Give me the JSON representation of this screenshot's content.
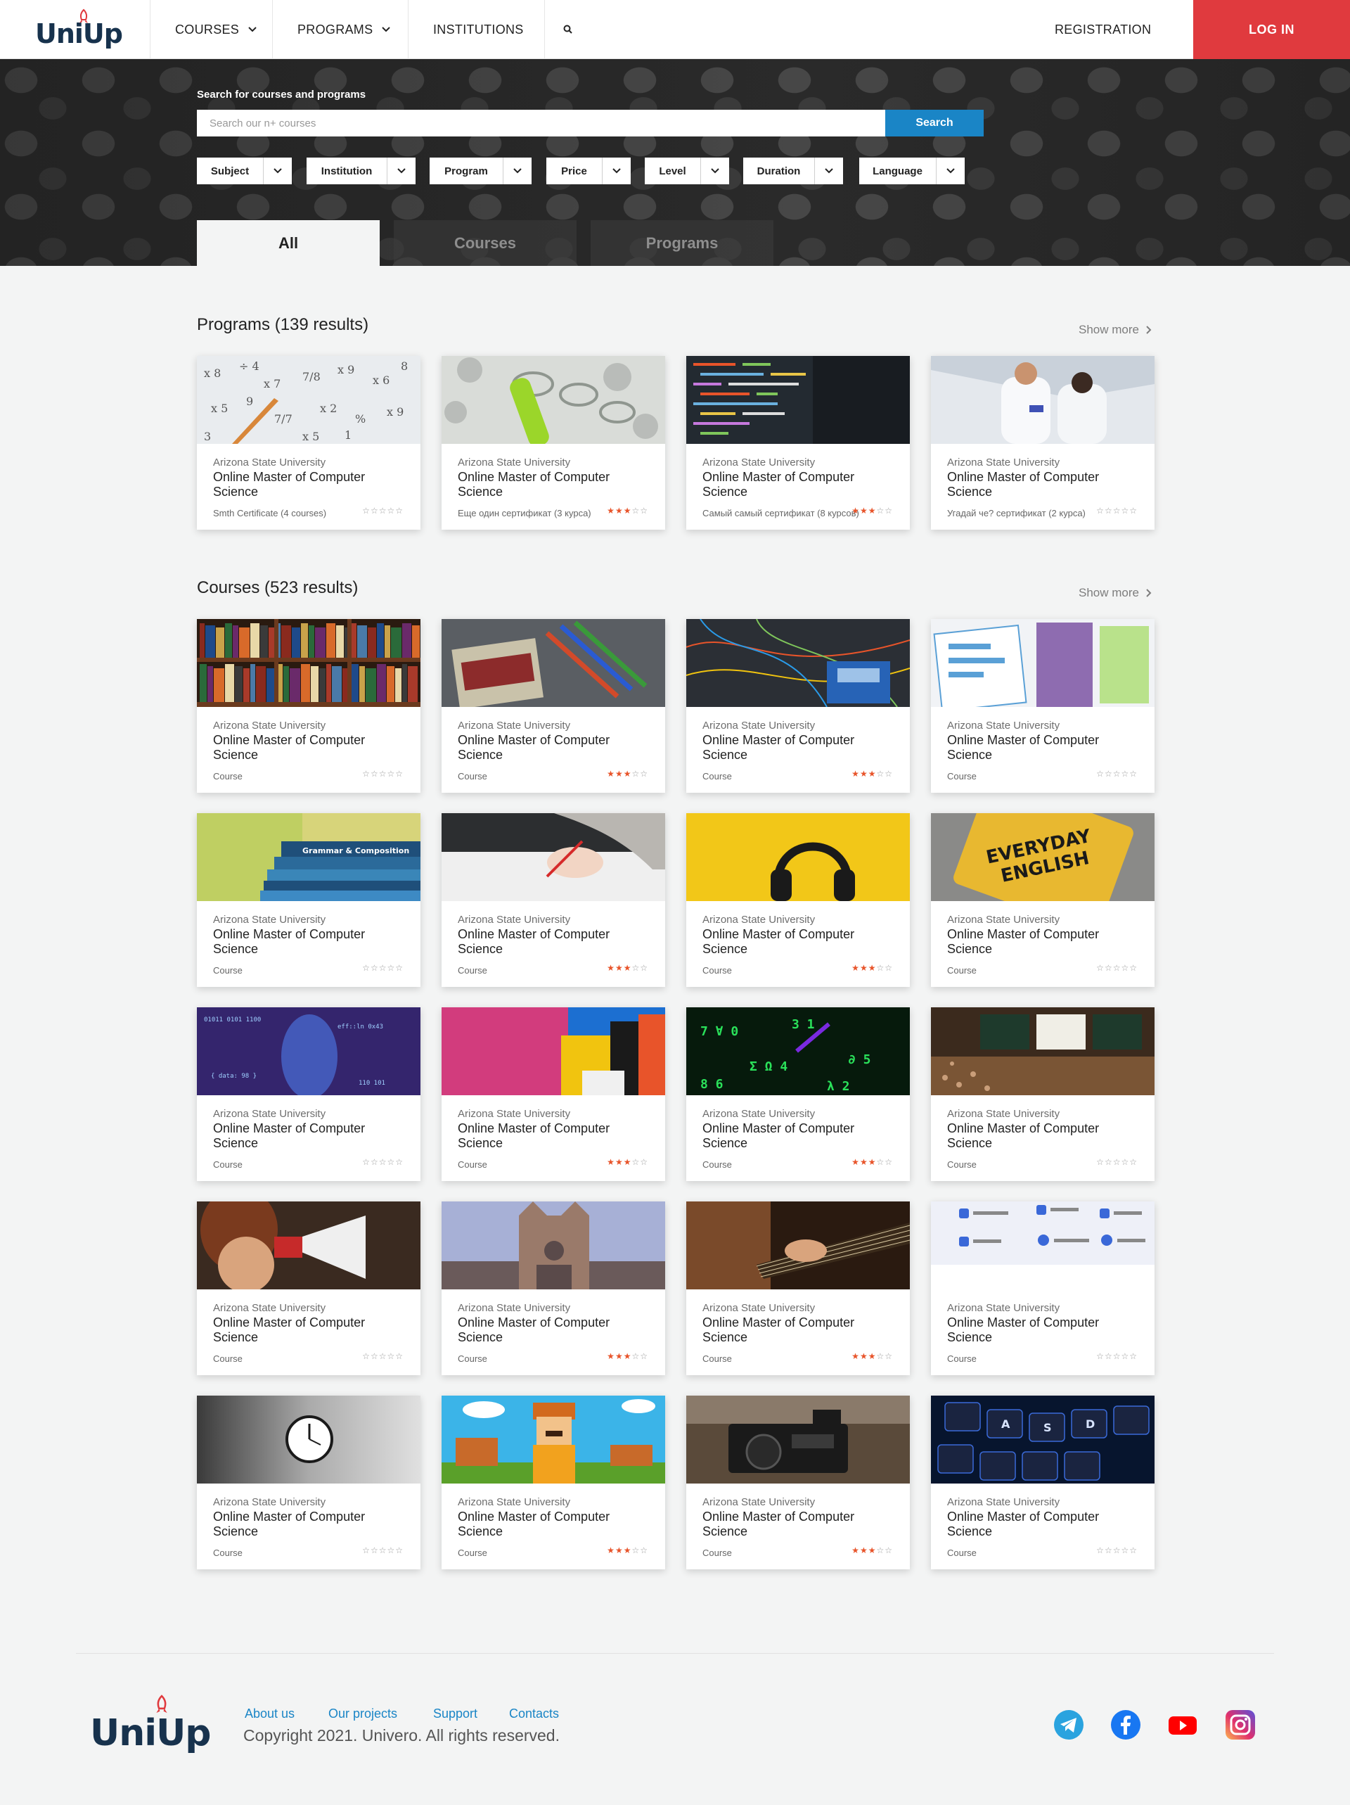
{
  "header": {
    "logo": "UniUp",
    "nav": [
      {
        "label": "COURSES",
        "has_dropdown": true
      },
      {
        "label": "PROGRAMS",
        "has_dropdown": true
      },
      {
        "label": "INSTITUTIONS",
        "has_dropdown": false
      }
    ],
    "search_icon": "search-icon",
    "registration": "REGISTRATION",
    "login": "LOG IN"
  },
  "hero": {
    "label": "Search for courses and programs",
    "search_placeholder": "Search our n+ courses",
    "search_button": "Search",
    "filters": [
      "Subject",
      "Institution",
      "Program",
      "Price",
      "Level",
      "Duration",
      "Language"
    ],
    "tabs": [
      {
        "label": "All",
        "active": true
      },
      {
        "label": "Courses",
        "active": false
      },
      {
        "label": "Programs",
        "active": false
      }
    ]
  },
  "programs": {
    "title": "Programs (139 results)",
    "show_more": "Show more",
    "cards": [
      {
        "institution": "Arizona State University",
        "title": "Online Master of Computer Science",
        "meta": "Smth Certificate (4 courses)",
        "rating": 0,
        "image": "math-worksheet"
      },
      {
        "institution": "Arizona State University",
        "title": "Online Master of Computer Science",
        "meta": "Еще один сертификат (3 курса)",
        "rating": 3,
        "image": "test-tubes"
      },
      {
        "institution": "Arizona State University",
        "title": "Online Master of Computer Science",
        "meta": "Самый самый сертификат (8 курсов)",
        "rating": 3,
        "image": "code-screen"
      },
      {
        "institution": "Arizona State University",
        "title": "Online Master of Computer Science",
        "meta": "Угадай че? сертификат (2 курса)",
        "rating": 0,
        "image": "scientists"
      }
    ]
  },
  "courses": {
    "title": "Courses (523 results)",
    "show_more": "Show more",
    "cards": [
      {
        "institution": "Arizona State University",
        "title": "Online Master of Computer Science",
        "meta": "Course",
        "rating": 0,
        "image": "bookshelf"
      },
      {
        "institution": "Arizona State University",
        "title": "Online Master of Computer Science",
        "meta": "Course",
        "rating": 3,
        "image": "crayons"
      },
      {
        "institution": "Arizona State University",
        "title": "Online Master of Computer Science",
        "meta": "Course",
        "rating": 3,
        "image": "electronics"
      },
      {
        "institution": "Arizona State University",
        "title": "Online Master of Computer Science",
        "meta": "Course",
        "rating": 0,
        "image": "wireframes"
      },
      {
        "institution": "Arizona State University",
        "title": "Online Master of Computer Science",
        "meta": "Course",
        "rating": 0,
        "image": "books-stack"
      },
      {
        "institution": "Arizona State University",
        "title": "Online Master of Computer Science",
        "meta": "Course",
        "rating": 3,
        "image": "writing-hand"
      },
      {
        "institution": "Arizona State University",
        "title": "Online Master of Computer Science",
        "meta": "Course",
        "rating": 3,
        "image": "headphones"
      },
      {
        "institution": "Arizona State University",
        "title": "Online Master of Computer Science",
        "meta": "Course",
        "rating": 0,
        "image": "everyday-english"
      },
      {
        "institution": "Arizona State University",
        "title": "Online Master of Computer Science",
        "meta": "Course",
        "rating": 0,
        "image": "data-face"
      },
      {
        "institution": "Arizona State University",
        "title": "Online Master of Computer Science",
        "meta": "Course",
        "rating": 3,
        "image": "color-blocks"
      },
      {
        "institution": "Arizona State University",
        "title": "Online Master of Computer Science",
        "meta": "Course",
        "rating": 3,
        "image": "green-code"
      },
      {
        "institution": "Arizona State University",
        "title": "Online Master of Computer Science",
        "meta": "Course",
        "rating": 0,
        "image": "lecture-hall"
      },
      {
        "institution": "Arizona State University",
        "title": "Online Master of Computer Science",
        "meta": "Course",
        "rating": 0,
        "image": "megaphone"
      },
      {
        "institution": "Arizona State University",
        "title": "Online Master of Computer Science",
        "meta": "Course",
        "rating": 3,
        "image": "cathedral"
      },
      {
        "institution": "Arizona State University",
        "title": "Online Master of Computer Science",
        "meta": "Course",
        "rating": 3,
        "image": "guitar"
      },
      {
        "institution": "Arizona State University",
        "title": "Online Master of Computer Science",
        "meta": "Course",
        "rating": 0,
        "image": "web-tools"
      },
      {
        "institution": "Arizona State University",
        "title": "Online Master of Computer Science",
        "meta": "Course",
        "rating": 0,
        "image": "wall-clock"
      },
      {
        "institution": "Arizona State University",
        "title": "Online Master of Computer Science",
        "meta": "Course",
        "rating": 3,
        "image": "lego-figure"
      },
      {
        "institution": "Arizona State University",
        "title": "Online Master of Computer Science",
        "meta": "Course",
        "rating": 3,
        "image": "camera"
      },
      {
        "institution": "Arizona State University",
        "title": "Online Master of Computer Science",
        "meta": "Course",
        "rating": 0,
        "image": "keyboard"
      }
    ]
  },
  "footer": {
    "logo": "UniUp",
    "links": [
      "About us",
      "Our projects",
      "Support",
      "Contacts"
    ],
    "copyright": "Copyright 2021. Univero. All rights reserved.",
    "social": [
      "telegram-icon",
      "facebook-icon",
      "youtube-icon",
      "instagram-icon"
    ]
  },
  "colors": {
    "accent_red": "#e03a3e",
    "accent_blue": "#1a85c6",
    "brand_navy": "#17324d",
    "star_orange": "#e8542a",
    "page_bg": "#f3f4f4"
  }
}
